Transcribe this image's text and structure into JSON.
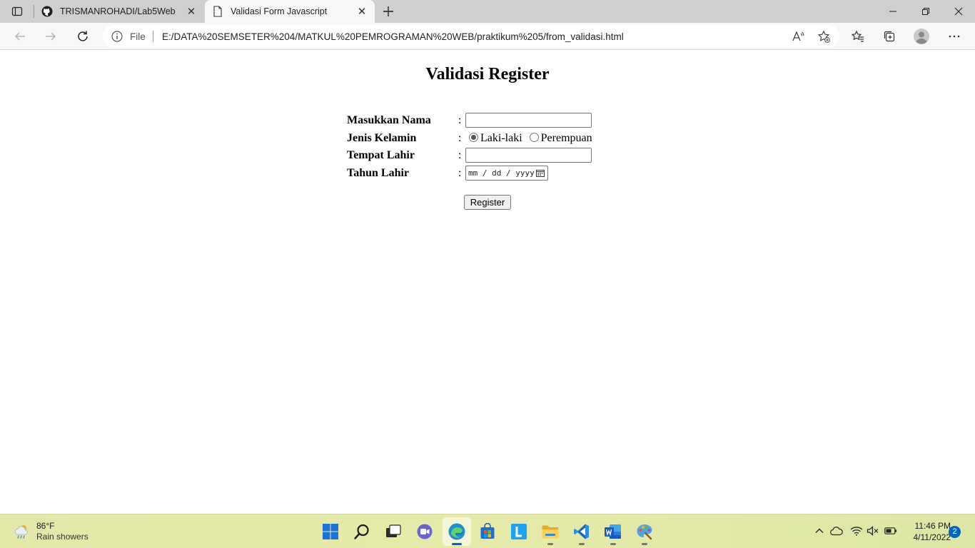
{
  "browser": {
    "tabs": [
      {
        "title": "TRISMANROHADI/Lab5Web",
        "icon": "github-icon",
        "active": false
      },
      {
        "title": "Validasi Form Javascript",
        "icon": "page-icon",
        "active": true
      }
    ],
    "address": {
      "scheme_label": "File",
      "url": "E:/DATA%20SEMSETER%204/MATKUL%20PEMROGRAMAN%20WEB/praktikum%205/from_validasi.html"
    }
  },
  "page": {
    "title": "Validasi Register",
    "fields": {
      "nama_label": "Masukkan Nama",
      "gender_label": "Jenis Kelamin",
      "gender_options": [
        "Laki-laki",
        "Perempuan"
      ],
      "gender_selected": "Laki-laki",
      "tempat_label": "Tempat Lahir",
      "tahun_label": "Tahun Lahir",
      "date_placeholder": "mm / dd / yyyy",
      "colon": ":"
    },
    "register_label": "Register"
  },
  "taskbar": {
    "weather": {
      "temp": "86°F",
      "condition": "Rain showers"
    },
    "apps": [
      "start",
      "search",
      "task-view",
      "chat",
      "edge",
      "store",
      "lexicon",
      "file-explorer",
      "vscode",
      "word",
      "paint"
    ],
    "clock": {
      "time": "11:46 PM",
      "date": "4/11/2022"
    },
    "notification_count": "2"
  },
  "colors": {
    "accent": "#0067c0",
    "tabstrip": "#cfcfcf",
    "toolbar": "#f7f7f7",
    "taskbar": "#e3e8a8"
  }
}
